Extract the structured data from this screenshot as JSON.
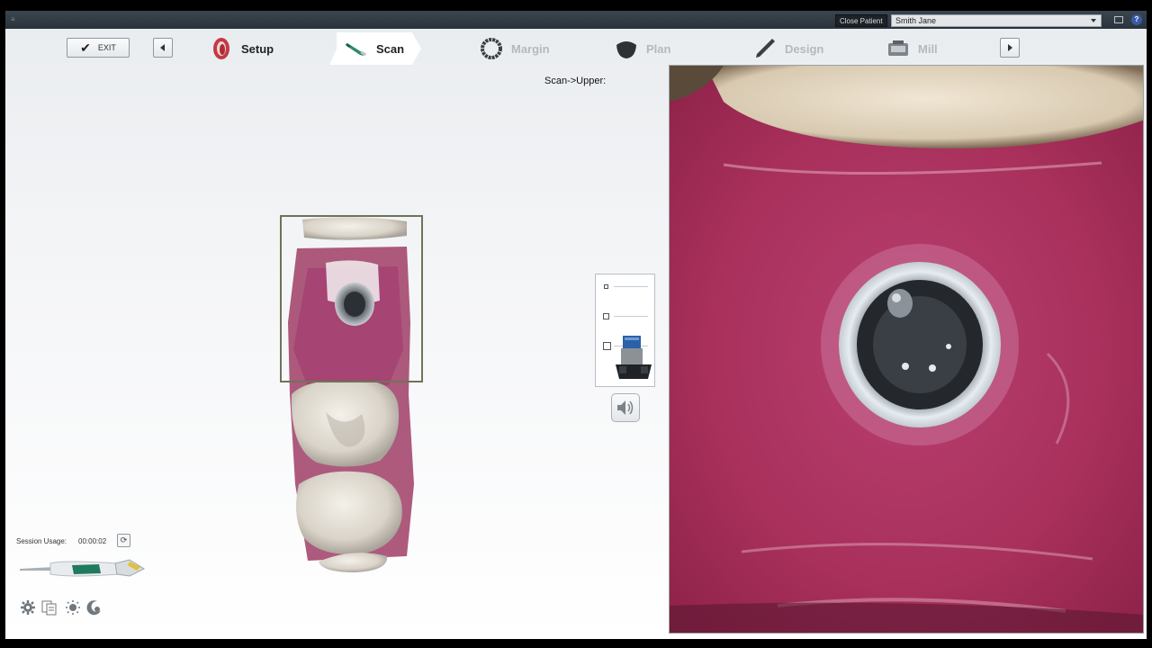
{
  "topbar": {
    "close_patient_label": "Close Patient",
    "patient_name": "Smith Jane",
    "help_label": "?"
  },
  "toolbar": {
    "exit_label": "EXIT",
    "steps": [
      {
        "label": "Setup",
        "state": "done",
        "icon": "jaw-icon"
      },
      {
        "label": "Scan",
        "state": "active",
        "icon": "scanner-wand-icon"
      },
      {
        "label": "Margin",
        "state": "disabled",
        "icon": "margin-ring-icon"
      },
      {
        "label": "Plan",
        "state": "disabled",
        "icon": "tooth-icon"
      },
      {
        "label": "Design",
        "state": "disabled",
        "icon": "pen-icon"
      },
      {
        "label": "Mill",
        "state": "disabled",
        "icon": "mill-machine-icon"
      }
    ]
  },
  "scan": {
    "label": "Scan->Upper:"
  },
  "session": {
    "label": "Session Usage:",
    "time": "00:00:02"
  },
  "colors": {
    "gum": "#b3365f",
    "tooth": "#e7e1d6",
    "frame_box": "#6f7358"
  }
}
